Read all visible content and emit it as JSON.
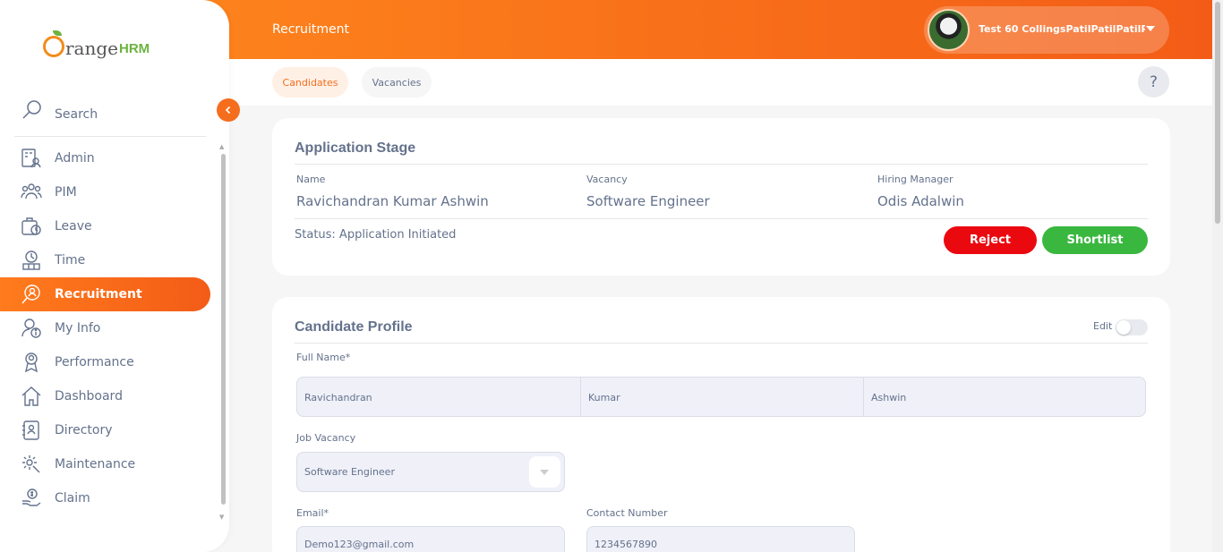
{
  "brand": {
    "name": "range",
    "suffix": "HRM"
  },
  "sidebar": {
    "search_label": "Search",
    "items": [
      {
        "label": "Admin",
        "icon": "admin-icon"
      },
      {
        "label": "PIM",
        "icon": "pim-icon"
      },
      {
        "label": "Leave",
        "icon": "leave-icon"
      },
      {
        "label": "Time",
        "icon": "time-icon"
      },
      {
        "label": "Recruitment",
        "icon": "recruitment-icon",
        "active": true
      },
      {
        "label": "My Info",
        "icon": "my-info-icon"
      },
      {
        "label": "Performance",
        "icon": "performance-icon"
      },
      {
        "label": "Dashboard",
        "icon": "dashboard-icon"
      },
      {
        "label": "Directory",
        "icon": "directory-icon"
      },
      {
        "label": "Maintenance",
        "icon": "maintenance-icon"
      },
      {
        "label": "Claim",
        "icon": "claim-icon"
      }
    ]
  },
  "header": {
    "title": "Recruitment",
    "user_name": "Test 60 CollingsPatilPatilPatilPatil"
  },
  "tabs": {
    "candidates": "Candidates",
    "vacancies": "Vacancies",
    "help": "?"
  },
  "application_stage": {
    "title": "Application Stage",
    "name_label": "Name",
    "name_value": "Ravichandran Kumar Ashwin",
    "vacancy_label": "Vacancy",
    "vacancy_value": "Software Engineer",
    "manager_label": "Hiring Manager",
    "manager_value": "Odis Adalwin",
    "status": "Status: Application Initiated",
    "reject_label": "Reject",
    "shortlist_label": "Shortlist"
  },
  "candidate_profile": {
    "title": "Candidate Profile",
    "edit_label": "Edit",
    "full_name_label": "Full Name*",
    "first_name": "Ravichandran",
    "middle_name": "Kumar",
    "last_name": "Ashwin",
    "job_vacancy_label": "Job Vacancy",
    "job_vacancy_value": "Software Engineer",
    "email_label": "Email*",
    "email_value": "Demo123@gmail.com",
    "contact_label": "Contact Number",
    "contact_value": "1234567890"
  },
  "colors": {
    "accent": "#f46e1d",
    "reject": "#eb0910",
    "shortlist": "#3ab73f",
    "text": "#64728c"
  }
}
